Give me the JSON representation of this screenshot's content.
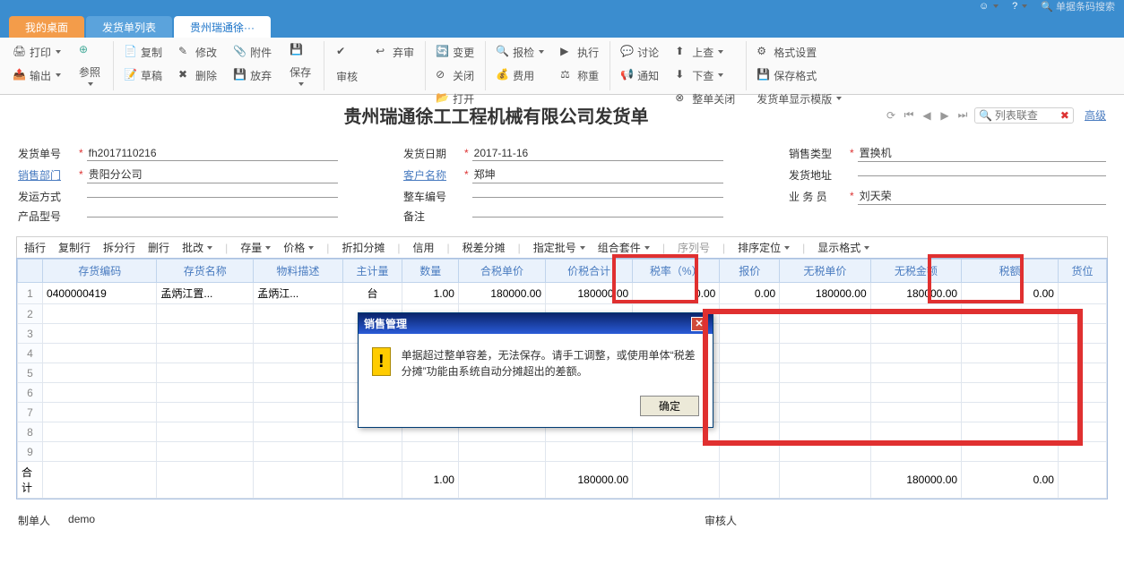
{
  "topbar": {
    "smiley": "☺",
    "help": "?",
    "search_placeholder": "单据条码搜索"
  },
  "tabs": [
    {
      "label": "我的桌面"
    },
    {
      "label": "发货单列表"
    },
    {
      "label": "贵州瑞通徐···"
    }
  ],
  "ribbon": {
    "print": "打印",
    "output": "输出",
    "ref": "参照",
    "copy": "复制",
    "draft": "草稿",
    "modify": "修改",
    "delete": "删除",
    "attach": "附件",
    "abandon": "放弃",
    "save": "保存",
    "audit": "审核",
    "unaudit": "弃审",
    "change": "变更",
    "close": "关闭",
    "open": "打开",
    "inspect": "报检",
    "fee": "费用",
    "exec": "执行",
    "weigh": "称重",
    "discuss": "讨论",
    "notify": "通知",
    "upquery": "上查",
    "downquery": "下查",
    "closewhole": "整单关闭",
    "format": "格式设置",
    "saveformat": "保存格式",
    "displaytmpl": "发货单显示模版"
  },
  "title": "贵州瑞通徐工工程机械有限公司发货单",
  "title_tools": {
    "list_search": "列表联查",
    "advanced": "高级"
  },
  "form": {
    "labels": {
      "ship_no": "发货单号",
      "sales_dept": "销售部门",
      "ship_method": "发运方式",
      "prod_model": "产品型号",
      "ship_date": "发货日期",
      "cust_name": "客户名称",
      "vehicle_no": "整车编号",
      "remark": "备注",
      "sales_type": "销售类型",
      "ship_addr": "发货地址",
      "operator": "业 务 员"
    },
    "values": {
      "ship_no": "fh2017110216",
      "sales_dept": "贵阳分公司",
      "ship_date": "2017-11-16",
      "cust_name": "郑坤",
      "sales_type": "置换机",
      "operator": "刘天荣"
    }
  },
  "grid_toolbar": {
    "insert": "插行",
    "copy": "复制行",
    "split": "拆分行",
    "delete": "删行",
    "batch": "批改",
    "stock": "存量",
    "price": "价格",
    "discount": "折扣分摊",
    "credit": "信用",
    "tax": "税差分摊",
    "batch_no": "指定批号",
    "combo": "组合套件",
    "serial": "序列号",
    "sort": "排序定位",
    "display": "显示格式"
  },
  "grid": {
    "headers": [
      "",
      "存货编码",
      "存货名称",
      "物料描述",
      "主计量",
      "数量",
      "合税单价",
      "价税合计",
      "税率（%）",
      "报价",
      "无税单价",
      "无税金额",
      "税额",
      "货位"
    ],
    "rows": [
      {
        "n": "1",
        "code": "0400000419",
        "name": "孟炳江置...",
        "desc": "孟炳江...",
        "uom": "台",
        "qty": "1.00",
        "taxprice": "180000.00",
        "taxtotal": "180000.00",
        "taxrate": "0.00",
        "quote": "0.00",
        "price": "180000.00",
        "amount": "180000.00",
        "tax": "0.00",
        "loc": ""
      },
      {
        "n": "2"
      },
      {
        "n": "3"
      },
      {
        "n": "4"
      },
      {
        "n": "5"
      },
      {
        "n": "6"
      },
      {
        "n": "7"
      },
      {
        "n": "8"
      },
      {
        "n": "9"
      }
    ],
    "sum_label": "合计",
    "sum": {
      "qty": "1.00",
      "taxtotal": "180000.00",
      "amount": "180000.00",
      "tax": "0.00"
    }
  },
  "dialog": {
    "title": "销售管理",
    "text": "单据超过整单容差，无法保存。请手工调整，或使用单体“税差分摊”功能由系统自动分摊超出的差额。",
    "ok": "确定"
  },
  "footer": {
    "creator_label": "制单人",
    "creator": "demo",
    "auditor_label": "审核人"
  }
}
